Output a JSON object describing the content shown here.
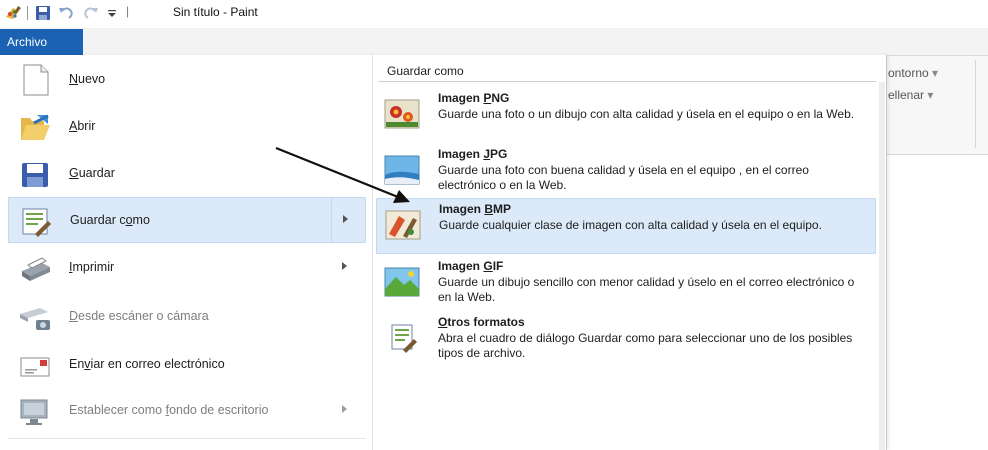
{
  "window": {
    "title": "Sin título - Paint",
    "qa_separator": "|"
  },
  "file_tab": {
    "label": "Archivo"
  },
  "ribbon": {
    "outline_label": "ontorno",
    "fill_label": "ellenar",
    "dropdown_glyph": "▾"
  },
  "left_menu": {
    "items": [
      {
        "pre": "",
        "key": "N",
        "post": "uevo",
        "dim": false
      },
      {
        "pre": "",
        "key": "A",
        "post": "brir",
        "dim": false
      },
      {
        "pre": "",
        "key": "G",
        "post": "uardar",
        "dim": false
      },
      {
        "pre": "Guardar c",
        "key": "o",
        "post": "mo",
        "dim": false
      },
      {
        "pre": "",
        "key": "I",
        "post": "mprimir",
        "dim": false
      },
      {
        "pre": "",
        "key": "D",
        "post": "esde escáner o cámara",
        "dim": true
      },
      {
        "pre": "En",
        "key": "v",
        "post": "iar en correo electrónico",
        "dim": false
      },
      {
        "pre": "Establecer como ",
        "key": "f",
        "post": "ondo de escritorio",
        "dim": true
      }
    ]
  },
  "submenu": {
    "title": "Guardar como",
    "options": [
      {
        "name_pre": "Imagen ",
        "name_key": "P",
        "name_post": "NG",
        "desc": "Guarde una foto o un dibujo con alta calidad y úsela en el equipo o en la Web."
      },
      {
        "name_pre": "Imagen ",
        "name_key": "J",
        "name_post": "PG",
        "desc": "Guarde una foto con buena calidad y úsela en el equipo , en el correo electrónico o en la Web."
      },
      {
        "name_pre": "Imagen ",
        "name_key": "B",
        "name_post": "MP",
        "desc": "Guarde cualquier clase de imagen con alta calidad y úsela en el equipo."
      },
      {
        "name_pre": "Imagen ",
        "name_key": "G",
        "name_post": "IF",
        "desc": "Guarde un dibujo sencillo con menor calidad y úselo en el correo electrónico o en la Web."
      },
      {
        "name_pre": "",
        "name_key": "O",
        "name_post": "tros formatos",
        "desc": "Abra el cuadro de diálogo Guardar como para seleccionar uno de los posibles tipos de archivo."
      }
    ]
  },
  "colors": {
    "accent": "#1b62b3",
    "selection": "#dbe9f9",
    "selection_border": "#c3d9f4"
  }
}
